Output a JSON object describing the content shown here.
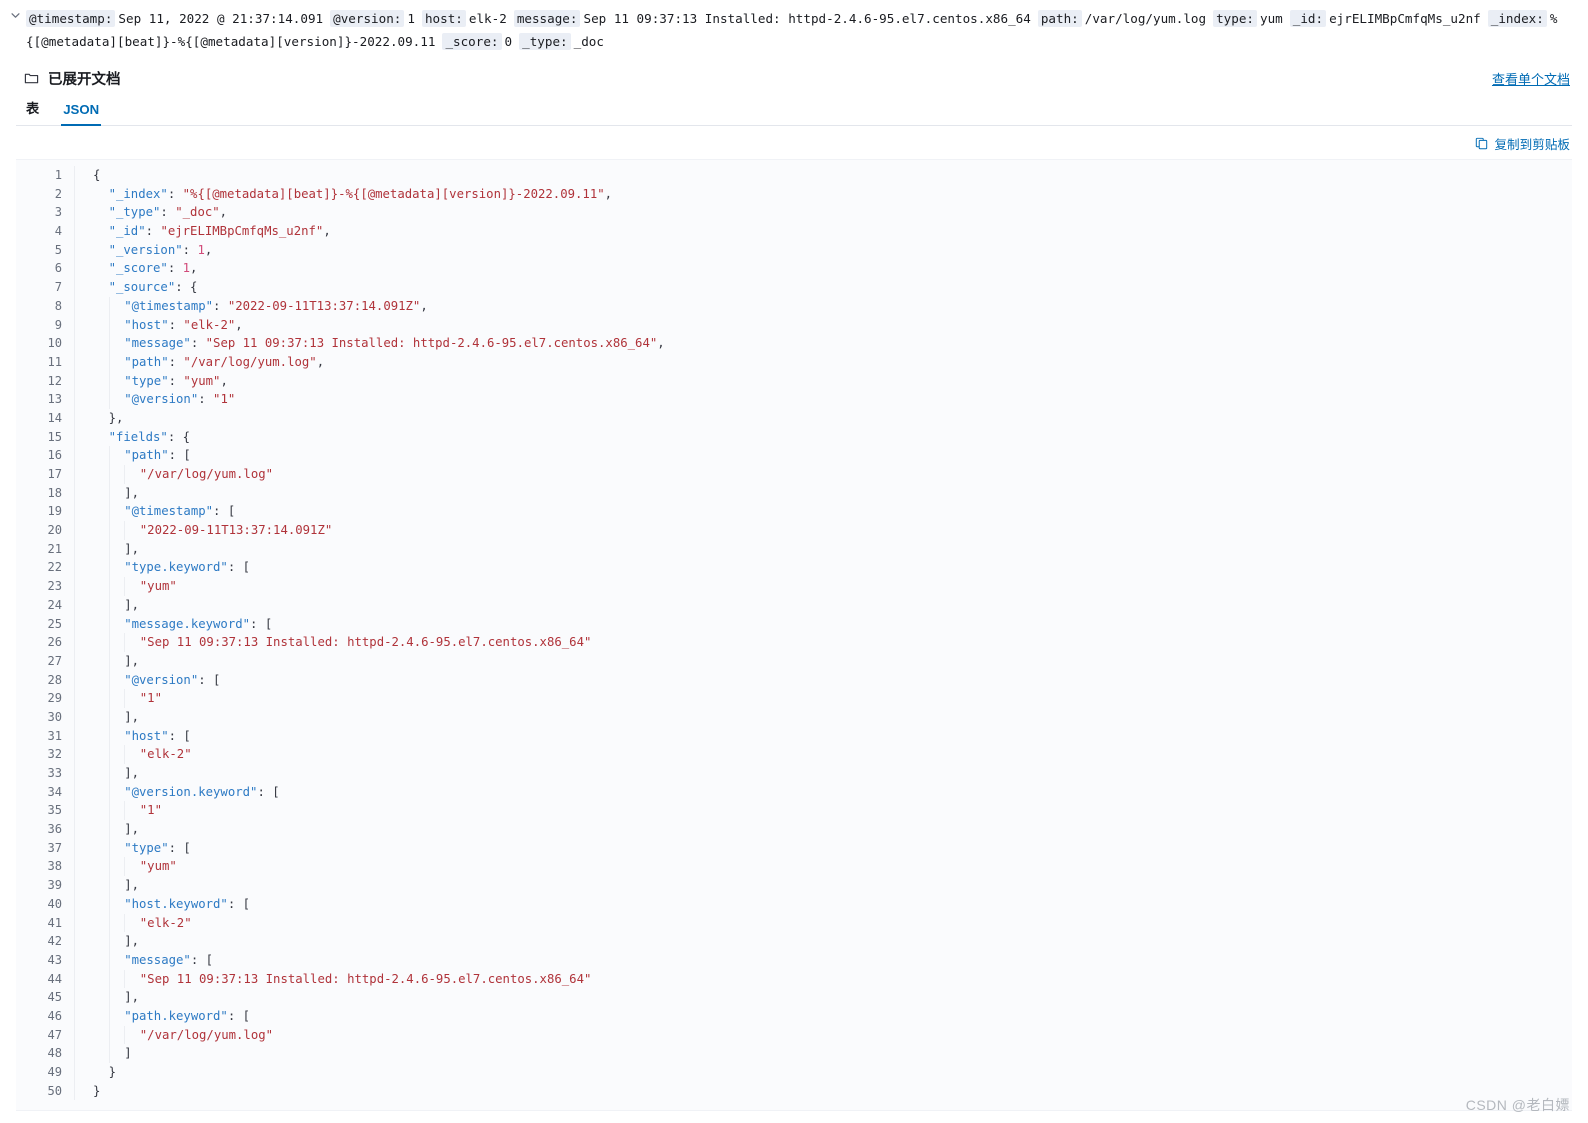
{
  "summary": {
    "expand_icon": "chevron-down-icon",
    "fields": [
      {
        "name": "@timestamp:",
        "value": "Sep 11, 2022 @ 21:37:14.091"
      },
      {
        "name": "@version:",
        "value": "1"
      },
      {
        "name": "host:",
        "value": "elk-2"
      },
      {
        "name": "message:",
        "value": "Sep 11 09:37:13 Installed: httpd-2.4.6-95.el7.centos.x86_64"
      },
      {
        "name": "path:",
        "value": "/var/log/yum.log"
      },
      {
        "name": "type:",
        "value": "yum"
      },
      {
        "name": "_id:",
        "value": "ejrELIMBpCmfqMs_u2nf"
      },
      {
        "name": "_index:",
        "value": "%{[@metadata][beat]}-%{[@metadata][version]}-2022.09.11"
      },
      {
        "name": "_score:",
        "value": "0"
      },
      {
        "name": "_type:",
        "value": "_doc"
      }
    ]
  },
  "panel": {
    "folder_icon": "folder-icon",
    "title": "已展开文档",
    "view_single_doc_link": "查看单个文档",
    "tabs": [
      {
        "label": "表",
        "active": false
      },
      {
        "label": "JSON",
        "active": true
      }
    ],
    "copy_icon": "copy-icon",
    "copy_label": "复制到剪贴板"
  },
  "colors": {
    "accent": "#006bb4",
    "key": "#2d7ac4",
    "string": "#b0333a",
    "number": "#d14b7a",
    "punct": "#343741",
    "code_bg": "#fafbfd",
    "field_chip_bg": "#eaeef5"
  },
  "json_lines": [
    {
      "n": 1,
      "indent": 0,
      "tokens": [
        {
          "t": "p",
          "v": "{"
        }
      ]
    },
    {
      "n": 2,
      "indent": 1,
      "tokens": [
        {
          "t": "k",
          "v": "\"_index\""
        },
        {
          "t": "p",
          "v": ": "
        },
        {
          "t": "s",
          "v": "\"%{[@metadata][beat]}-%{[@metadata][version]}-2022.09.11\""
        },
        {
          "t": "p",
          "v": ","
        }
      ]
    },
    {
      "n": 3,
      "indent": 1,
      "tokens": [
        {
          "t": "k",
          "v": "\"_type\""
        },
        {
          "t": "p",
          "v": ": "
        },
        {
          "t": "s",
          "v": "\"_doc\""
        },
        {
          "t": "p",
          "v": ","
        }
      ]
    },
    {
      "n": 4,
      "indent": 1,
      "tokens": [
        {
          "t": "k",
          "v": "\"_id\""
        },
        {
          "t": "p",
          "v": ": "
        },
        {
          "t": "s",
          "v": "\"ejrELIMBpCmfqMs_u2nf\""
        },
        {
          "t": "p",
          "v": ","
        }
      ]
    },
    {
      "n": 5,
      "indent": 1,
      "tokens": [
        {
          "t": "k",
          "v": "\"_version\""
        },
        {
          "t": "p",
          "v": ": "
        },
        {
          "t": "n",
          "v": "1"
        },
        {
          "t": "p",
          "v": ","
        }
      ]
    },
    {
      "n": 6,
      "indent": 1,
      "tokens": [
        {
          "t": "k",
          "v": "\"_score\""
        },
        {
          "t": "p",
          "v": ": "
        },
        {
          "t": "n",
          "v": "1"
        },
        {
          "t": "p",
          "v": ","
        }
      ]
    },
    {
      "n": 7,
      "indent": 1,
      "tokens": [
        {
          "t": "k",
          "v": "\"_source\""
        },
        {
          "t": "p",
          "v": ": {"
        }
      ]
    },
    {
      "n": 8,
      "indent": 2,
      "tokens": [
        {
          "t": "k",
          "v": "\"@timestamp\""
        },
        {
          "t": "p",
          "v": ": "
        },
        {
          "t": "s",
          "v": "\"2022-09-11T13:37:14.091Z\""
        },
        {
          "t": "p",
          "v": ","
        }
      ]
    },
    {
      "n": 9,
      "indent": 2,
      "tokens": [
        {
          "t": "k",
          "v": "\"host\""
        },
        {
          "t": "p",
          "v": ": "
        },
        {
          "t": "s",
          "v": "\"elk-2\""
        },
        {
          "t": "p",
          "v": ","
        }
      ]
    },
    {
      "n": 10,
      "indent": 2,
      "tokens": [
        {
          "t": "k",
          "v": "\"message\""
        },
        {
          "t": "p",
          "v": ": "
        },
        {
          "t": "s",
          "v": "\"Sep 11 09:37:13 Installed: httpd-2.4.6-95.el7.centos.x86_64\""
        },
        {
          "t": "p",
          "v": ","
        }
      ]
    },
    {
      "n": 11,
      "indent": 2,
      "tokens": [
        {
          "t": "k",
          "v": "\"path\""
        },
        {
          "t": "p",
          "v": ": "
        },
        {
          "t": "s",
          "v": "\"/var/log/yum.log\""
        },
        {
          "t": "p",
          "v": ","
        }
      ]
    },
    {
      "n": 12,
      "indent": 2,
      "tokens": [
        {
          "t": "k",
          "v": "\"type\""
        },
        {
          "t": "p",
          "v": ": "
        },
        {
          "t": "s",
          "v": "\"yum\""
        },
        {
          "t": "p",
          "v": ","
        }
      ]
    },
    {
      "n": 13,
      "indent": 2,
      "tokens": [
        {
          "t": "k",
          "v": "\"@version\""
        },
        {
          "t": "p",
          "v": ": "
        },
        {
          "t": "s",
          "v": "\"1\""
        }
      ]
    },
    {
      "n": 14,
      "indent": 1,
      "tokens": [
        {
          "t": "p",
          "v": "},"
        }
      ]
    },
    {
      "n": 15,
      "indent": 1,
      "tokens": [
        {
          "t": "k",
          "v": "\"fields\""
        },
        {
          "t": "p",
          "v": ": {"
        }
      ]
    },
    {
      "n": 16,
      "indent": 2,
      "tokens": [
        {
          "t": "k",
          "v": "\"path\""
        },
        {
          "t": "p",
          "v": ": ["
        }
      ]
    },
    {
      "n": 17,
      "indent": 3,
      "tokens": [
        {
          "t": "s",
          "v": "\"/var/log/yum.log\""
        }
      ]
    },
    {
      "n": 18,
      "indent": 2,
      "tokens": [
        {
          "t": "p",
          "v": "],"
        }
      ]
    },
    {
      "n": 19,
      "indent": 2,
      "tokens": [
        {
          "t": "k",
          "v": "\"@timestamp\""
        },
        {
          "t": "p",
          "v": ": ["
        }
      ]
    },
    {
      "n": 20,
      "indent": 3,
      "tokens": [
        {
          "t": "s",
          "v": "\"2022-09-11T13:37:14.091Z\""
        }
      ]
    },
    {
      "n": 21,
      "indent": 2,
      "tokens": [
        {
          "t": "p",
          "v": "],"
        }
      ]
    },
    {
      "n": 22,
      "indent": 2,
      "tokens": [
        {
          "t": "k",
          "v": "\"type.keyword\""
        },
        {
          "t": "p",
          "v": ": ["
        }
      ]
    },
    {
      "n": 23,
      "indent": 3,
      "tokens": [
        {
          "t": "s",
          "v": "\"yum\""
        }
      ]
    },
    {
      "n": 24,
      "indent": 2,
      "tokens": [
        {
          "t": "p",
          "v": "],"
        }
      ]
    },
    {
      "n": 25,
      "indent": 2,
      "tokens": [
        {
          "t": "k",
          "v": "\"message.keyword\""
        },
        {
          "t": "p",
          "v": ": ["
        }
      ]
    },
    {
      "n": 26,
      "indent": 3,
      "tokens": [
        {
          "t": "s",
          "v": "\"Sep 11 09:37:13 Installed: httpd-2.4.6-95.el7.centos.x86_64\""
        }
      ]
    },
    {
      "n": 27,
      "indent": 2,
      "tokens": [
        {
          "t": "p",
          "v": "],"
        }
      ]
    },
    {
      "n": 28,
      "indent": 2,
      "tokens": [
        {
          "t": "k",
          "v": "\"@version\""
        },
        {
          "t": "p",
          "v": ": ["
        }
      ]
    },
    {
      "n": 29,
      "indent": 3,
      "tokens": [
        {
          "t": "s",
          "v": "\"1\""
        }
      ]
    },
    {
      "n": 30,
      "indent": 2,
      "tokens": [
        {
          "t": "p",
          "v": "],"
        }
      ]
    },
    {
      "n": 31,
      "indent": 2,
      "tokens": [
        {
          "t": "k",
          "v": "\"host\""
        },
        {
          "t": "p",
          "v": ": ["
        }
      ]
    },
    {
      "n": 32,
      "indent": 3,
      "tokens": [
        {
          "t": "s",
          "v": "\"elk-2\""
        }
      ]
    },
    {
      "n": 33,
      "indent": 2,
      "tokens": [
        {
          "t": "p",
          "v": "],"
        }
      ]
    },
    {
      "n": 34,
      "indent": 2,
      "tokens": [
        {
          "t": "k",
          "v": "\"@version.keyword\""
        },
        {
          "t": "p",
          "v": ": ["
        }
      ]
    },
    {
      "n": 35,
      "indent": 3,
      "tokens": [
        {
          "t": "s",
          "v": "\"1\""
        }
      ]
    },
    {
      "n": 36,
      "indent": 2,
      "tokens": [
        {
          "t": "p",
          "v": "],"
        }
      ]
    },
    {
      "n": 37,
      "indent": 2,
      "tokens": [
        {
          "t": "k",
          "v": "\"type\""
        },
        {
          "t": "p",
          "v": ": ["
        }
      ]
    },
    {
      "n": 38,
      "indent": 3,
      "tokens": [
        {
          "t": "s",
          "v": "\"yum\""
        }
      ]
    },
    {
      "n": 39,
      "indent": 2,
      "tokens": [
        {
          "t": "p",
          "v": "],"
        }
      ]
    },
    {
      "n": 40,
      "indent": 2,
      "tokens": [
        {
          "t": "k",
          "v": "\"host.keyword\""
        },
        {
          "t": "p",
          "v": ": ["
        }
      ]
    },
    {
      "n": 41,
      "indent": 3,
      "tokens": [
        {
          "t": "s",
          "v": "\"elk-2\""
        }
      ]
    },
    {
      "n": 42,
      "indent": 2,
      "tokens": [
        {
          "t": "p",
          "v": "],"
        }
      ]
    },
    {
      "n": 43,
      "indent": 2,
      "tokens": [
        {
          "t": "k",
          "v": "\"message\""
        },
        {
          "t": "p",
          "v": ": ["
        }
      ]
    },
    {
      "n": 44,
      "indent": 3,
      "tokens": [
        {
          "t": "s",
          "v": "\"Sep 11 09:37:13 Installed: httpd-2.4.6-95.el7.centos.x86_64\""
        }
      ]
    },
    {
      "n": 45,
      "indent": 2,
      "tokens": [
        {
          "t": "p",
          "v": "],"
        }
      ]
    },
    {
      "n": 46,
      "indent": 2,
      "tokens": [
        {
          "t": "k",
          "v": "\"path.keyword\""
        },
        {
          "t": "p",
          "v": ": ["
        }
      ]
    },
    {
      "n": 47,
      "indent": 3,
      "tokens": [
        {
          "t": "s",
          "v": "\"/var/log/yum.log\""
        }
      ]
    },
    {
      "n": 48,
      "indent": 2,
      "tokens": [
        {
          "t": "p",
          "v": "]"
        }
      ]
    },
    {
      "n": 49,
      "indent": 1,
      "tokens": [
        {
          "t": "p",
          "v": "}"
        }
      ]
    },
    {
      "n": 50,
      "indent": 0,
      "tokens": [
        {
          "t": "p",
          "v": "}"
        }
      ]
    }
  ],
  "watermark": "CSDN @老白嫖"
}
